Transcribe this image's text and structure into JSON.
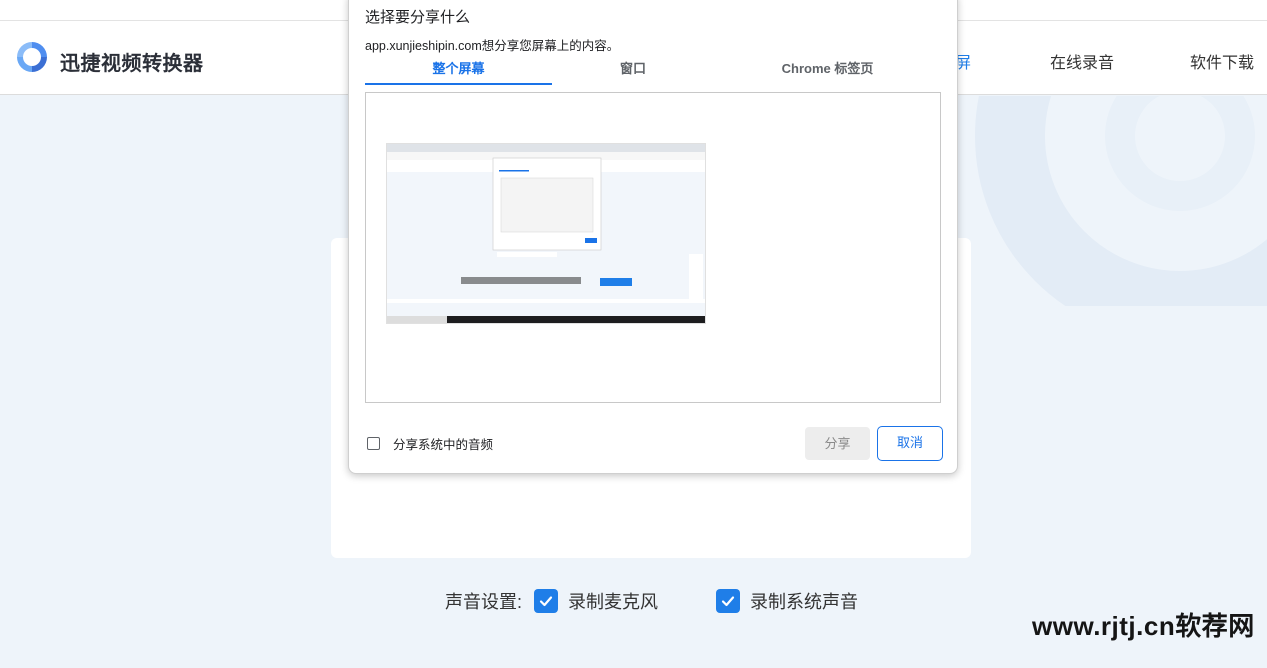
{
  "header": {
    "app_name": "迅捷视频转换器",
    "nav": {
      "active_fragment": "屏",
      "online_record": "在线录音",
      "software_download": "软件下载"
    }
  },
  "sound_settings": {
    "label": "声音设置:",
    "options": [
      {
        "label": "录制麦克风",
        "checked": true
      },
      {
        "label": "录制系统声音",
        "checked": true
      }
    ]
  },
  "watermark": "www.rjtj.cn软荐网",
  "share_dialog": {
    "title": "选择要分享什么",
    "subtitle": "app.xunjieshipin.com想分享您屏幕上的内容。",
    "tabs": [
      {
        "label": "整个屏幕",
        "active": true
      },
      {
        "label": "窗口",
        "active": false
      },
      {
        "label": "Chrome 标签页",
        "active": false
      }
    ],
    "audio_checkbox_label": "分享系统中的音频",
    "audio_checked": false,
    "share_button": "分享",
    "cancel_button": "取消"
  },
  "colors": {
    "accent": "#1f7ee8",
    "dialog_accent": "#1a73e8",
    "page_background": "#eef4fa"
  }
}
